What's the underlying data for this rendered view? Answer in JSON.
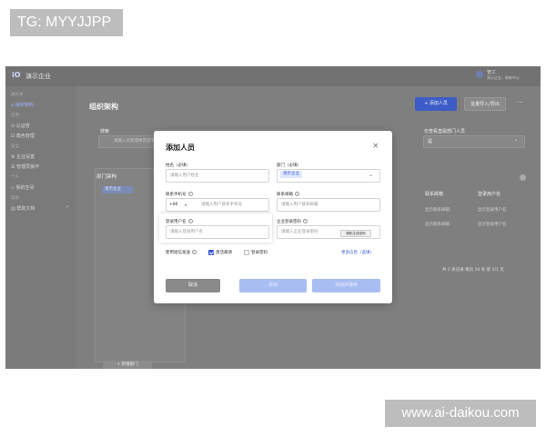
{
  "watermarks": {
    "top": "TG: MYYJJPP",
    "bottom": "www.ai-daikou.com"
  },
  "topbar": {
    "logo": "iO",
    "brand": "演示企业",
    "user_name": "管工",
    "user_sub": "演示企业，刷新中心"
  },
  "sidebar": {
    "items": [
      {
        "label": "通讯录",
        "type": "group"
      },
      {
        "label": "组织架构",
        "type": "item",
        "active": true
      },
      {
        "label": "应用",
        "type": "group"
      },
      {
        "label": "认证管",
        "type": "item"
      },
      {
        "label": "角色管理",
        "type": "item"
      },
      {
        "label": "安全",
        "type": "group"
      },
      {
        "label": "企业设置",
        "type": "item"
      },
      {
        "label": "管理员操作",
        "type": "item"
      },
      {
        "label": "个人",
        "type": "group"
      },
      {
        "label": "我的空间",
        "type": "item"
      },
      {
        "label": "帮助",
        "type": "group"
      },
      {
        "label": "帮助文档",
        "type": "item",
        "tag": "↗"
      }
    ]
  },
  "main": {
    "title": "组织架构",
    "add_button": "+ 添加人员",
    "batch_button": "批量导入/导出",
    "more": "···",
    "search_label": "搜索",
    "search_placeholder": "请输入名称或拼音首字母",
    "show_label": "仅查看直属部门人员",
    "show_value": "是",
    "org_title": "部门架构",
    "org_node": "演示企业",
    "org_add": "+ 新增部门",
    "table_headers": [
      "联系邮箱",
      "登录用户名"
    ],
    "table_rows": [
      [
        "显示联系邮箱",
        "显示登录用户名"
      ],
      [
        "显示联系邮箱",
        "显示登录用户名"
      ]
    ],
    "pagination": "共 2 条记录  每页 10 条  第 1/1 页"
  },
  "modal": {
    "title": "添加人员",
    "close": "×",
    "fields": {
      "name": {
        "label": "姓名（必填）",
        "placeholder": "请输入用户姓名"
      },
      "dept": {
        "label": "部门（必填）",
        "tag": "演示企业"
      },
      "phone": {
        "label": "联系手机号",
        "country_code": "+86",
        "placeholder": "请输入用户联系手机号"
      },
      "email": {
        "label": "联系邮箱",
        "placeholder": "请输入用户联系邮箱"
      },
      "username": {
        "label": "登录用户名",
        "placeholder": "请输入登录用户名"
      },
      "password": {
        "label": "企业登录密码",
        "placeholder": "请输入企业登录密码",
        "gen_button": "随机生成密码"
      }
    },
    "notify_label": "使用短信发送",
    "opt_activate": "激活邀请",
    "opt_password": "登录密码",
    "more_info": "更多信息（选填）",
    "cancel": "取消",
    "confirm": "添加",
    "confirm_next": "添加并继续"
  },
  "colors": {
    "accent": "#3a5bd9",
    "overlay": "#7f7f7f"
  }
}
